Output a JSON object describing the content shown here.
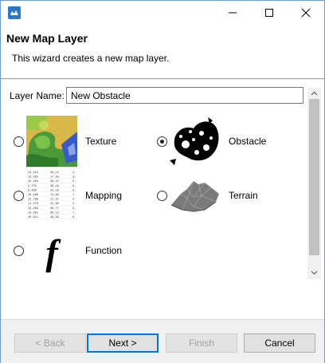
{
  "window": {
    "title": "",
    "accent": "#2a78c8"
  },
  "banner": {
    "title": "New Map Layer",
    "description": "This wizard creates a new map layer."
  },
  "form": {
    "layer_name_label": "Layer Name:",
    "layer_name_value": "New Obstacle"
  },
  "options": [
    {
      "label": "Texture",
      "checked": false,
      "icon": "texture-icon"
    },
    {
      "label": "Obstacle",
      "checked": true,
      "icon": "obstacle-icon"
    },
    {
      "label": "Mapping",
      "checked": false,
      "icon": "mapping-icon"
    },
    {
      "label": "Terrain",
      "checked": false,
      "icon": "terrain-icon"
    },
    {
      "label": "Function",
      "checked": false,
      "icon": "function-icon"
    }
  ],
  "mapping_table": [
    [
      "14.413",
      "59.13",
      "4."
    ],
    [
      "13.482",
      "17.20",
      "3."
    ],
    [
      "15.204",
      "29.23",
      "5."
    ],
    [
      "5.776",
      "39.18",
      "6."
    ],
    [
      "9.499",
      "50.19",
      "3."
    ],
    [
      "10.560",
      "74.69",
      "7."
    ],
    [
      "12.788",
      "21.37",
      "4."
    ],
    [
      "11.276",
      "41.80",
      "5."
    ],
    [
      "11.209",
      "30.77",
      "3."
    ],
    [
      "14.861",
      "66.13",
      "7."
    ],
    [
      "20.311",
      "38.99",
      "8."
    ]
  ],
  "footer": {
    "back_label": "< Back",
    "next_label": "Next >",
    "finish_label": "Finish",
    "cancel_label": "Cancel"
  }
}
